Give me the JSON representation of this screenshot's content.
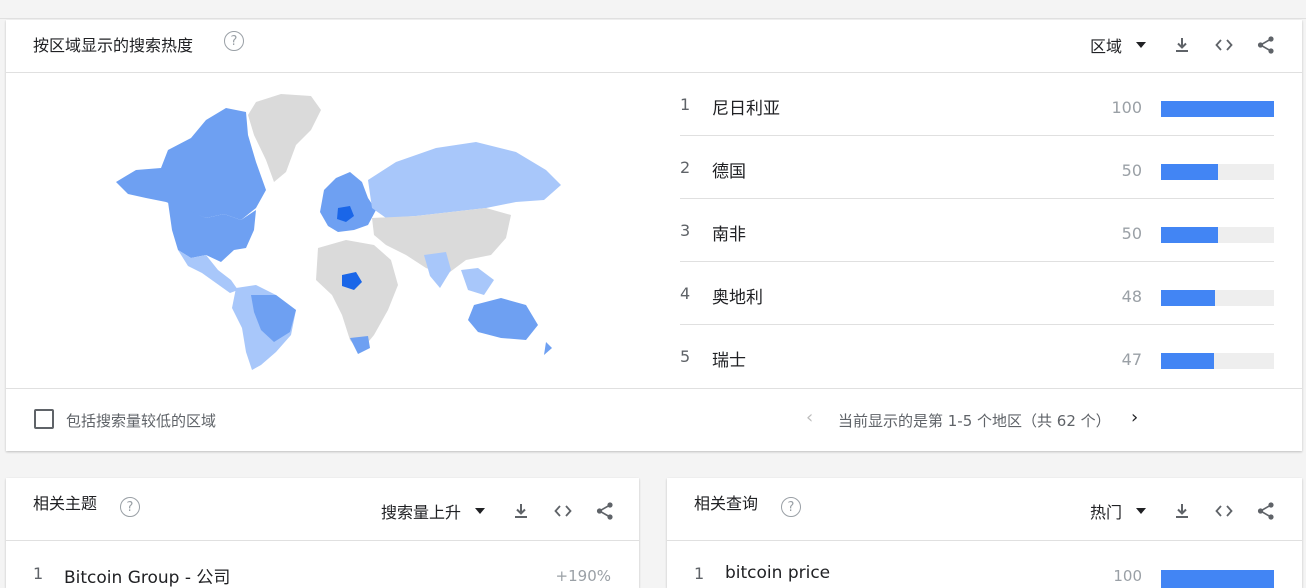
{
  "geo": {
    "title": "按区域显示的搜索热度",
    "help": "?",
    "dropdown": "区域",
    "items": [
      {
        "rank": "1",
        "name": "尼日利亚",
        "value": 100
      },
      {
        "rank": "2",
        "name": "德国",
        "value": 50
      },
      {
        "rank": "3",
        "name": "南非",
        "value": 50
      },
      {
        "rank": "4",
        "name": "奥地利",
        "value": 48
      },
      {
        "rank": "5",
        "name": "瑞士",
        "value": 47
      }
    ],
    "checkbox_label": "包括搜索量较低的区域",
    "pager_text": "当前显示的是第 1-5 个地区（共 62 个）",
    "pager_prev": "‹",
    "pager_next": "›"
  },
  "topics": {
    "title": "相关主题",
    "help": "?",
    "dropdown": "搜索量上升",
    "first_rank": "1",
    "first_name": "Bitcoin Group - 公司",
    "first_value": "+190%"
  },
  "queries": {
    "title": "相关查询",
    "help": "?",
    "dropdown": "热门",
    "first_rank": "1",
    "first_name": "bitcoin price",
    "first_value": "100"
  },
  "colors": {
    "bar": "#4285f4",
    "map_high": "#1a66e8",
    "map_mid": "#6ea0f2",
    "map_low": "#a8c7fa",
    "map_none": "#dadada"
  },
  "icons": [
    "help-icon",
    "caret-down-icon",
    "download-icon",
    "embed-icon",
    "share-icon",
    "chevron-left-icon",
    "chevron-right-icon",
    "checkbox-icon"
  ]
}
